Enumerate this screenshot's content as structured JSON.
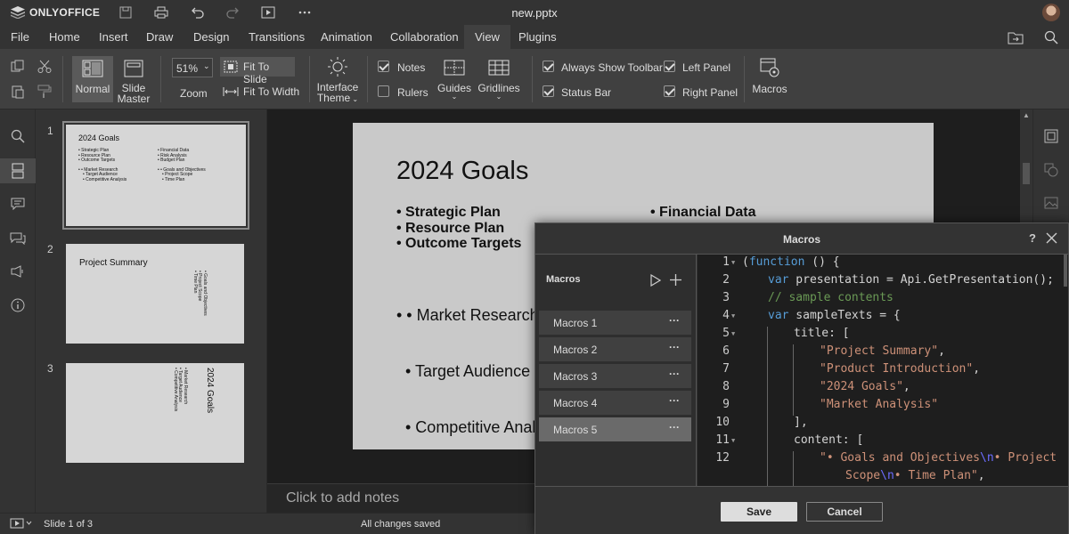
{
  "app": {
    "logo_text": "ONLYOFFICE",
    "document_title": "new.pptx"
  },
  "menu": {
    "tabs": [
      "File",
      "Home",
      "Insert",
      "Draw",
      "Design",
      "Transitions",
      "Animation",
      "Collaboration",
      "View",
      "Plugins"
    ],
    "active_tab": "View"
  },
  "toolbar": {
    "normal_label": "Normal",
    "slide_master_line1": "Slide",
    "slide_master_line2": "Master",
    "zoom_value": "51%",
    "zoom_label": "Zoom",
    "fit_to_slide": "Fit To Slide",
    "fit_to_width": "Fit To Width",
    "interface_theme_line1": "Interface",
    "interface_theme_line2": "Theme",
    "notes_label": "Notes",
    "notes_checked": true,
    "rulers_label": "Rulers",
    "rulers_checked": false,
    "guides_label": "Guides",
    "gridlines_label": "Gridlines",
    "always_show_toolbar_label": "Always Show Toolbar",
    "always_show_toolbar_checked": true,
    "status_bar_label": "Status Bar",
    "status_bar_checked": true,
    "left_panel_label": "Left Panel",
    "left_panel_checked": true,
    "right_panel_label": "Right Panel",
    "right_panel_checked": true,
    "macros_label": "Macros"
  },
  "thumbnails": [
    {
      "number": "1",
      "title": "2024 Goals",
      "left_items": [
        "• Strategic Plan",
        "• Resource Plan",
        "• Outcome Targets"
      ],
      "left_sub": [
        "• • Market Research",
        "  • Target Audience",
        "  • Competitive Analysis"
      ],
      "right_items": [
        "• Financial Data",
        "• Risk Analysis",
        "• Budget Plan"
      ],
      "right_sub": [
        "• • Goals and Objectives",
        "  • Project Scope",
        "  • Time Plan"
      ]
    },
    {
      "number": "2",
      "title": "Project Summary",
      "rotated_lines": [
        "• Goals and Objectives",
        "• Project Scope",
        "• Time Plan"
      ]
    },
    {
      "number": "3",
      "rotated_title": "2024 Goals",
      "rotated_lines": [
        "• Market Research",
        "• Target Audience",
        "• Competitive Analysis"
      ]
    }
  ],
  "slide": {
    "title": "2024 Goals",
    "bullets_left": [
      "• Strategic Plan",
      "• Resource Plan",
      "• Outcome Targets"
    ],
    "bullets_right_first": "• Financial Data",
    "sub_bullets": [
      "• • Market Research",
      "  • Target Audience",
      "  • Competitive Analysis"
    ]
  },
  "notes_placeholder": "Click to add notes",
  "statusbar": {
    "slide_counter": "Slide 1 of 3",
    "save_status": "All changes saved"
  },
  "macros_dialog": {
    "title": "Macros",
    "help": "?",
    "list_header": "Macros",
    "items": [
      "Macros 1",
      "Macros 2",
      "Macros 3",
      "Macros 4",
      "Macros 5"
    ],
    "selected_item": "Macros 5",
    "item_menu": "···",
    "save_label": "Save",
    "cancel_label": "Cancel",
    "code_lines": [
      {
        "n": "1",
        "fold": true,
        "indent": 0,
        "tokens": [
          [
            "p",
            "("
          ],
          [
            "kw",
            "function"
          ],
          [
            "p",
            " () {"
          ]
        ]
      },
      {
        "n": "2",
        "fold": false,
        "indent": 1,
        "tokens": [
          [
            "kw",
            "var"
          ],
          [
            "p",
            " presentation = Api.GetPresentation();"
          ]
        ]
      },
      {
        "n": "3",
        "fold": false,
        "indent": 1,
        "tokens": [
          [
            "cmt",
            "// sample contents"
          ]
        ]
      },
      {
        "n": "4",
        "fold": true,
        "indent": 1,
        "tokens": [
          [
            "kw",
            "var"
          ],
          [
            "p",
            " sampleTexts = {"
          ]
        ]
      },
      {
        "n": "5",
        "fold": true,
        "indent": 2,
        "tokens": [
          [
            "p",
            "title: ["
          ]
        ]
      },
      {
        "n": "6",
        "fold": false,
        "indent": 3,
        "tokens": [
          [
            "str",
            "\"Project Summary\""
          ],
          [
            "p",
            ","
          ]
        ]
      },
      {
        "n": "7",
        "fold": false,
        "indent": 3,
        "tokens": [
          [
            "str",
            "\"Product Introduction\""
          ],
          [
            "p",
            ","
          ]
        ]
      },
      {
        "n": "8",
        "fold": false,
        "indent": 3,
        "tokens": [
          [
            "str",
            "\"2024 Goals\""
          ],
          [
            "p",
            ","
          ]
        ]
      },
      {
        "n": "9",
        "fold": false,
        "indent": 3,
        "tokens": [
          [
            "str",
            "\"Market Analysis\""
          ]
        ]
      },
      {
        "n": "10",
        "fold": false,
        "indent": 2,
        "tokens": [
          [
            "p",
            "],"
          ]
        ]
      },
      {
        "n": "11",
        "fold": true,
        "indent": 2,
        "tokens": [
          [
            "p",
            "content: ["
          ]
        ]
      },
      {
        "n": "12",
        "fold": false,
        "indent": 3,
        "tokens": [
          [
            "str",
            "\"• Goals and Objectives"
          ],
          [
            "esc",
            "\\n"
          ],
          [
            "str",
            "• Project"
          ]
        ]
      },
      {
        "n": "",
        "fold": false,
        "indent": 4,
        "tokens": [
          [
            "str",
            "Scope"
          ],
          [
            "esc",
            "\\n"
          ],
          [
            "str",
            "• Time Plan\""
          ],
          [
            "p",
            ","
          ]
        ]
      }
    ]
  }
}
